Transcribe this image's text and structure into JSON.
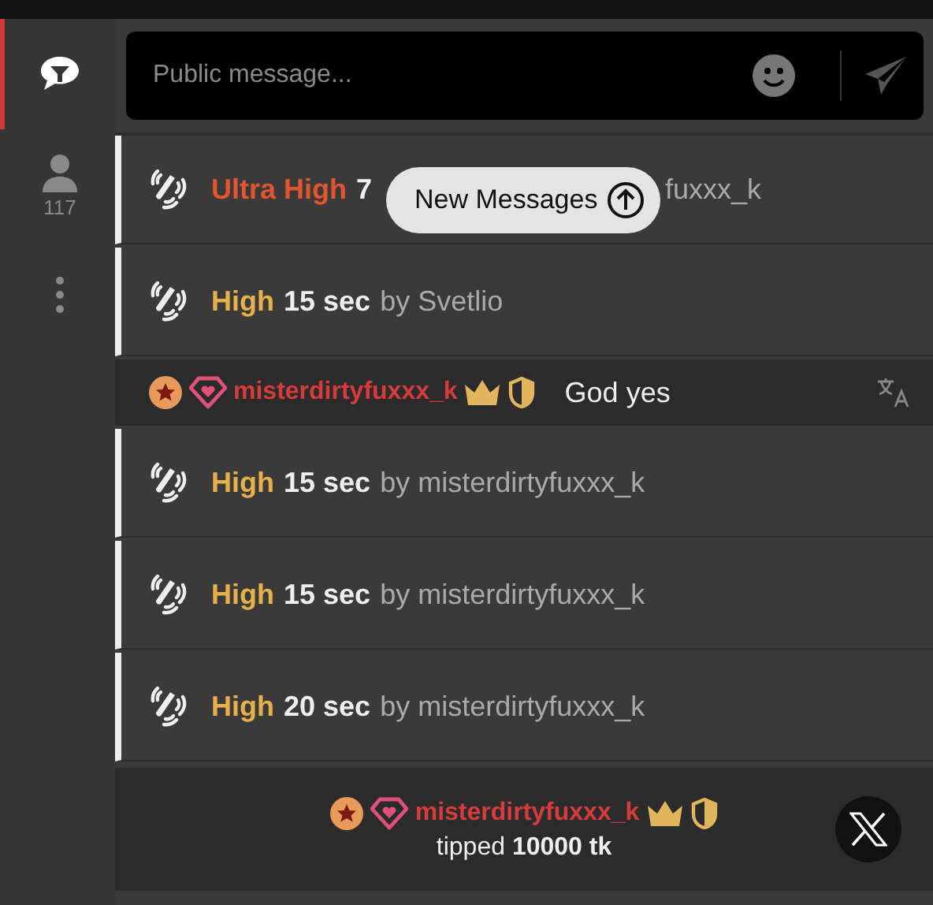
{
  "sidebar": {
    "items": [
      {
        "kind": "chat",
        "selected": true
      },
      {
        "kind": "users",
        "count": "117",
        "selected": false
      },
      {
        "kind": "more",
        "selected": false
      }
    ]
  },
  "composer": {
    "placeholder": "Public message..."
  },
  "new_messages": {
    "label": "New Messages"
  },
  "messages": [
    {
      "kind": "toy_under_popup",
      "level": "Ultra High",
      "color": "#e2562f",
      "duration": "7",
      "by": "fuxxx_k"
    },
    {
      "kind": "toy",
      "level": "High",
      "color": "#e7b04b",
      "duration": "15 sec",
      "by": "by Svetlio"
    },
    {
      "kind": "chat",
      "user": "misterdirtyfuxxx_k",
      "text": "God yes"
    },
    {
      "kind": "toy",
      "level": "High",
      "color": "#e7b04b",
      "duration": "15 sec",
      "by": "by misterdirtyfuxxx_k"
    },
    {
      "kind": "toy",
      "level": "High",
      "color": "#e7b04b",
      "duration": "15 sec",
      "by": "by misterdirtyfuxxx_k"
    },
    {
      "kind": "toy",
      "level": "High",
      "color": "#e7b04b",
      "duration": "20 sec",
      "by": "by misterdirtyfuxxx_k"
    },
    {
      "kind": "tip",
      "user": "misterdirtyfuxxx_k",
      "text": "tipped **10000 tk**"
    }
  ]
}
